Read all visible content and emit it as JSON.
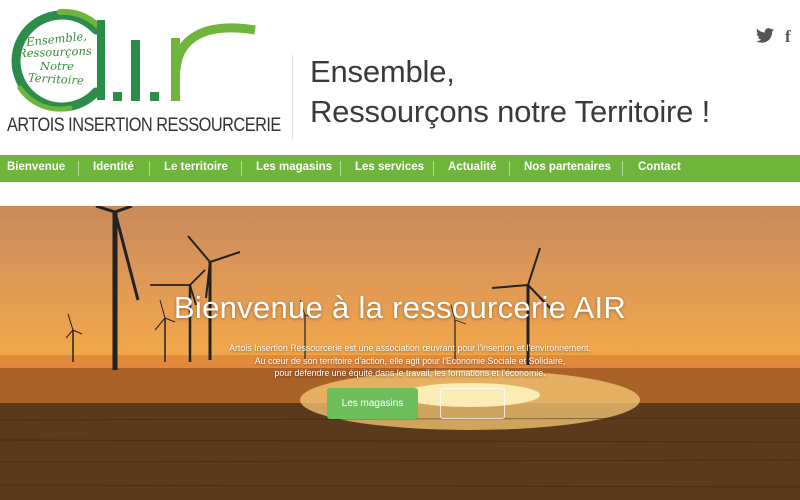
{
  "logo": {
    "big_text": "a.i.r",
    "tagline_lines": [
      "Ensemble,",
      "Ressourçons",
      "Notre",
      "Territoire"
    ],
    "name": "ARTOIS INSERTION RESSOURCERIE",
    "brand_green": "#6fb53b",
    "logo_green": "#2c8c4c"
  },
  "header": {
    "tagline_line1": "Ensemble,",
    "tagline_line2": "Ressourçons notre Territoire !",
    "social_icons": [
      "twitter-icon",
      "facebook-icon"
    ]
  },
  "nav": {
    "items": [
      {
        "label": "Bienvenue"
      },
      {
        "label": "Identité"
      },
      {
        "label": "Le territoire"
      },
      {
        "label": "Les magasins"
      },
      {
        "label": "Les services"
      },
      {
        "label": "Actualité"
      },
      {
        "label": "Nos partenaires"
      },
      {
        "label": "Contact"
      }
    ],
    "background": "#6fb53b"
  },
  "hero": {
    "title": "Bienvenue à la ressourcerie AIR",
    "text_lines": [
      "Artois Insertion Ressourcerie est une association œuvrant pour l'insertion et l'environnement.",
      "Au cœur de son territoire d'action, elle agit pour l'Economie Sociale et Solidaire,",
      "pour défendre une équité dans le travail, les formations et l'économie."
    ],
    "primary_button": "Les magasins",
    "secondary_button": "",
    "button_color": "#6cbf5a"
  }
}
